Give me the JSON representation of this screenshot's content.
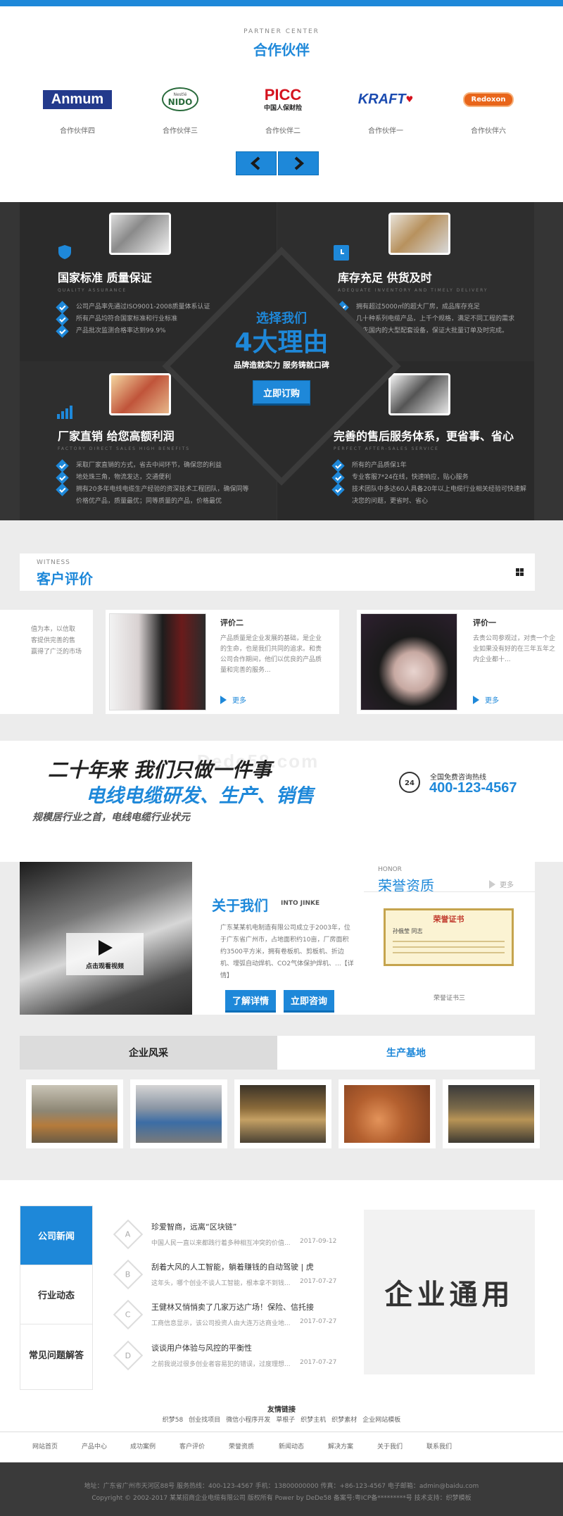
{
  "partners": {
    "sub_en": "PARTNER CENTER",
    "title": "合作伙伴",
    "logos": [
      {
        "logo_text": "Anmum",
        "caption": "合作伙伴四"
      },
      {
        "logo_text": "NIDO",
        "logo_small": "Nestlé",
        "caption": "合作伙伴三"
      },
      {
        "logo_text": "PICC",
        "logo_small": "中国人保财险",
        "caption": "合作伙伴二"
      },
      {
        "logo_text": "KRAFT",
        "caption": "合作伙伴一"
      },
      {
        "logo_text": "Redoxon",
        "caption": "合作伙伴六"
      }
    ]
  },
  "reasons": {
    "center_title": "选择我们",
    "center_big": "4大理由",
    "center_slogan": "品牌造就实力 服务铸就口碑",
    "center_button": "立即订购",
    "items": [
      {
        "title": "国家标准 质量保证",
        "sub": "QUALITY ASSURANCE",
        "list": [
          "公司产品率先通过ISO9001-2008质量体系认证",
          "所有产品均符合国家标准和行业标准",
          "产品批次监测合格率达到99.9%"
        ]
      },
      {
        "title": "库存充足 供货及时",
        "sub": "ADEQUATE INVENTORY AND TIMELY DELIVERY",
        "list": [
          "拥有超过5000㎡的超大厂房，成品库存充足",
          "几十种系列电缆产品，上千个规格，满足不同工程的需求",
          "领先国内的大型配套设备，保证大批量订单及时完成。"
        ]
      },
      {
        "title": "厂家直销 给您高额利润",
        "sub": "FACTORY DIRECT SALES HIGH BENEFITS",
        "list": [
          "采取厂家直销的方式，省去中间环节，确保您的利益",
          "地处珠三角，物流发达，交通便利",
          "拥有20多年电线电缆生产经验的资深技术工程团队，确保同等",
          "价格优产品，质量最优；同等质量的产品，价格最优"
        ]
      },
      {
        "title": "完善的售后服务体系，更省事、省心",
        "sub": "PERFECT AFTER-SALES SERVICE",
        "list": [
          "所有的产品质保1年",
          "专业客服7*24在线，快速响应，贴心服务",
          "技术团队中多达60人具备20年以上电缆行业相关经验可快速解",
          "决您的问题，更省时、省心"
        ]
      }
    ]
  },
  "witness": {
    "sub_en": "WITNESS",
    "title": "客户评价",
    "partial_text": [
      "值为本，以信取",
      "客提供完善的售",
      "赢得了广泛的市场"
    ],
    "reviews": [
      {
        "name": "评价二",
        "text": "产品质量是企业发展的基础，是企业的生命，也是我们共同的追求。和贵公司合作期间，他们以优良的产品质量和完善的服务...",
        "more": "更多"
      },
      {
        "name": "评价一",
        "text": "去贵公司参观过，对贵一个企业如果没有好的在三年五年之内企业都十...",
        "more": "更多"
      }
    ]
  },
  "banner": {
    "line1": "二十年来 我们只做一件事",
    "line2": "电线电缆研发、生产、销售",
    "line3": "规模居行业之首，电线电缆行业状元",
    "hotline_label": "全国免费咨询热线",
    "hotline": "400-123-4567",
    "watermark": "Dede58.com"
  },
  "about": {
    "video_caption": "点击观看视频",
    "title": "关于我们",
    "title_en": "INTO JINKE",
    "text": "广东某某机电制造有限公司成立于2003年，位于广东省广州市，占地面积约10亩，厂房面积约3500平方米，拥有卷板机、剪板机、折边机、埋弧自动焊机、CO2气体保护焊机、...【详情】",
    "btn_detail": "了解详情",
    "btn_consult": "立即咨询"
  },
  "honor": {
    "sub_en": "HONOR",
    "title": "荣誉资质",
    "more": "更多",
    "cert_title": "荣誉证书",
    "cert_name": "孙俄莹 同志",
    "cert_caption": "荣誉证书三"
  },
  "gallery": {
    "tabs": [
      "企业风采",
      "生产基地"
    ]
  },
  "news": {
    "tabs": [
      "公司新闻",
      "行业动态",
      "常见问题解答"
    ],
    "items": [
      {
        "mark": "A",
        "title": "珍爱智商，远离“区块链”",
        "summary": "中国人民一直以来都践行着多种相互冲突的价值...",
        "date": "2017-09-12"
      },
      {
        "mark": "B",
        "title": "刮着大风的人工智能，躺着赚钱的自动驾驶 | 虎",
        "summary": "这年头，哪个创业不谈人工智能，根本拿不到钱...",
        "date": "2017-07-27"
      },
      {
        "mark": "C",
        "title": "王健林又悄悄卖了几家万达广场！保险、信托接",
        "summary": "工商信息显示，该公司投资人由大连万达商业地...",
        "date": "2017-07-27"
      },
      {
        "mark": "D",
        "title": "谈谈用户体验与风控的平衡性",
        "summary": "之前我说过很多创业者容易犯的错误，过度理想...",
        "date": "2017-07-27"
      }
    ],
    "brand_text": "企业通用"
  },
  "links": {
    "title": "友情链接",
    "items": [
      "织梦58",
      "创业找项目",
      "微信小程序开发",
      "草根子",
      "织梦主机",
      "织梦素材",
      "企业网站模板"
    ]
  },
  "nav": [
    "网站首页",
    "产品中心",
    "成功案例",
    "客户评价",
    "荣誉资质",
    "新闻动态",
    "解决方案",
    "关于我们",
    "联系我们"
  ],
  "footer": {
    "line1": "地址：广东省广州市天河区88号 服务热线：400-123-4567 手机：13800000000 传真：+86-123-4567 电子邮箱：admin@baidu.com",
    "line2": "Copyright © 2002-2017 某某招商企业电缆有限公司 版权所有 Power by DeDe58 备案号:粤ICP备*********号 技术支持：织梦模板"
  },
  "colors": {
    "accent": "#1e88d9",
    "dark": "#353535"
  }
}
